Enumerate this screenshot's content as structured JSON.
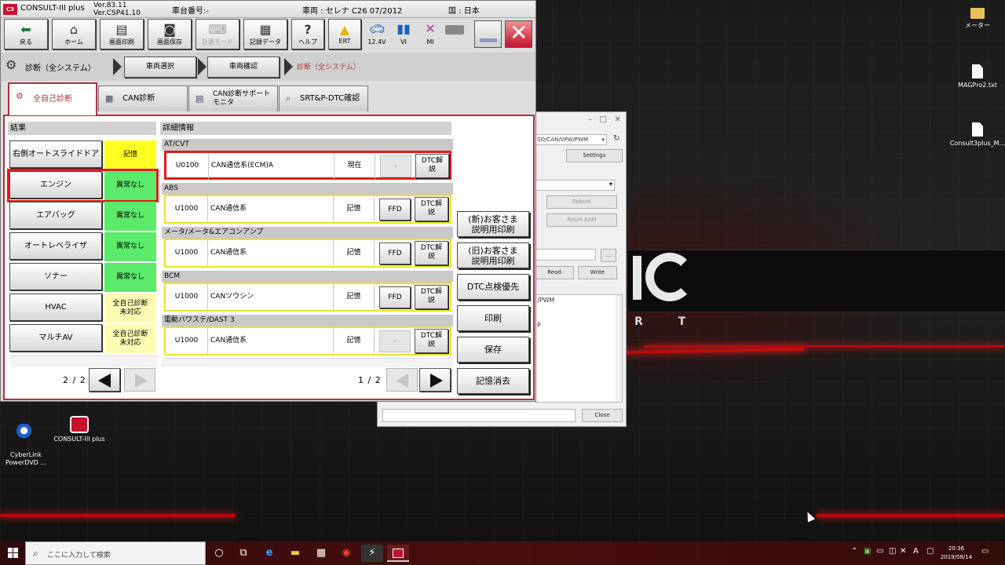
{
  "titlebar": {
    "app_name": "CONSULT-III plus",
    "ver1": "Ver.83.11",
    "ver2": "Ver.CSP41.10",
    "chassis_label": "車台番号:-",
    "vehicle": "車両 : セレナ C26 07/2012",
    "country": "国 : 日本"
  },
  "toolbar": {
    "back": "戻る",
    "home": "ホーム",
    "print_screen": "画面印刷",
    "save_screen": "画面保存",
    "measure_mode": "計測モード",
    "record_data": "記録データ",
    "help": "ヘルプ",
    "ert": "ERT",
    "voltage": "12.4V",
    "vi": "VI",
    "mi": "MI"
  },
  "breadcrumb": {
    "current_mode": "診断（全システム）",
    "step1": "車両選択",
    "step2": "車両確認",
    "step3": "診断（全システム）"
  },
  "tabs": [
    {
      "label": "全自己診断"
    },
    {
      "label": "CAN診断"
    },
    {
      "label": "CAN診断サポートモニタ"
    },
    {
      "label": "SRT&P-DTC確認"
    }
  ],
  "results": {
    "title": "結果",
    "rows": [
      {
        "name": "右側オートスライドドア",
        "status": "記憶",
        "status_color": "#ffff22"
      },
      {
        "name": "エンジン",
        "status": "異常なし",
        "status_color": "#5cea6a"
      },
      {
        "name": "エアバッグ",
        "status": "異常なし",
        "status_color": "#5cea6a"
      },
      {
        "name": "オートレベライザ",
        "status": "異常なし",
        "status_color": "#5cea6a"
      },
      {
        "name": "ソナー",
        "status": "異常なし",
        "status_color": "#5cea6a"
      },
      {
        "name": "HVAC",
        "status": "全自己診断\n未対応",
        "status_color": "#fffbb2"
      },
      {
        "name": "マルチAV",
        "status": "全自己診断\n未対応",
        "status_color": "#fffbb2"
      }
    ],
    "page": "2 / 2"
  },
  "details": {
    "title": "詳細情報",
    "groups": [
      {
        "system": "AT/CVT",
        "code": "U0100",
        "desc": "CAN通信系(ECM)A",
        "state": "現在",
        "ffd": "–",
        "dtc": "DTC解\n説"
      },
      {
        "system": "ABS",
        "code": "U1000",
        "desc": "CAN通信系",
        "state": "記憶",
        "ffd": "FFD",
        "dtc": "DTC解\n説"
      },
      {
        "system": "メータ/メータ&エアコンアンプ",
        "code": "U1000",
        "desc": "CAN通信系",
        "state": "記憶",
        "ffd": "FFD",
        "dtc": "DTC解\n説"
      },
      {
        "system": "BCM",
        "code": "U1000",
        "desc": "CANツウシン",
        "state": "記憶",
        "ffd": "FFD",
        "dtc": "DTC解\n説"
      },
      {
        "system": "電動パワステ/DAST 3",
        "code": "U1000",
        "desc": "CAN通信系",
        "state": "記憶",
        "ffd": "–",
        "dtc": "DTC解\n説"
      }
    ],
    "page": "1 / 2"
  },
  "side_buttons": {
    "new_print": "(新)お客さま\n説明用印刷",
    "old_print": "(旧)お客さま\n説明用印刷",
    "dtc_priority": "DTC点検優先",
    "print": "印刷",
    "save": "保存",
    "clear": "記憶消去"
  },
  "bgwin": {
    "protocol": "SO/CAN/VPW/PWM",
    "settings": "Settings",
    "reboot": "Reboot",
    "reset_kam": "Reset KAM",
    "browse": "...",
    "read": "Read",
    "write": "Write",
    "log1": "/PWM",
    "log2": "P",
    "close": "Close"
  },
  "desktop_icons": {
    "meter": "メーター",
    "magpro": "MAGPro2.txt",
    "consult_m": "Consult3plus_M...",
    "cyberlink": "CyberLink\nPowerDVD ...",
    "consult_app": "CONSULT-III plus"
  },
  "taskbar": {
    "search_placeholder": "ここに入力して検索",
    "time": "20:36",
    "date": "2019/08/14",
    "ime": "A"
  },
  "colors": {
    "accent": "#b03040",
    "highlight": "#e21a1a"
  }
}
